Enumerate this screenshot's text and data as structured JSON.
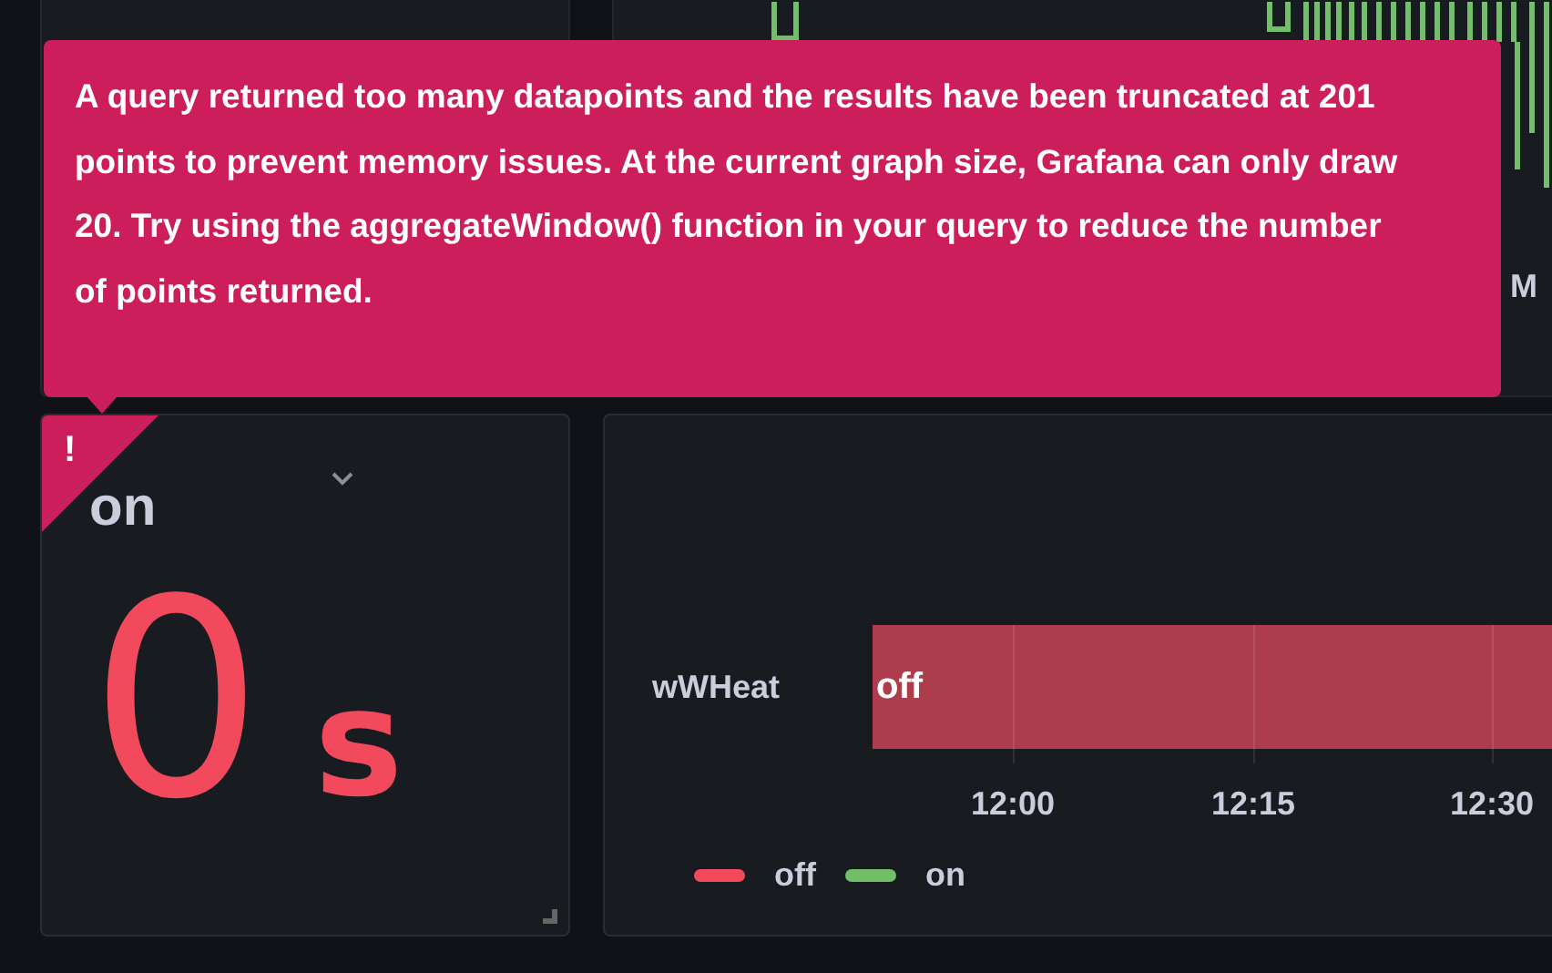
{
  "top_panel": {
    "axis_label": "M"
  },
  "alert": {
    "icon": "!",
    "message": "A query returned too many datapoints and the results have been truncated at 201 points to prevent memory issues. At the current graph size, Grafana can only draw 20. Try using the aggregateWindow() function in your query to reduce the number of points returned."
  },
  "stat_panel": {
    "title": "on",
    "value": "0",
    "unit": "s",
    "color": "#f2495c"
  },
  "state_timeline": {
    "rows": [
      {
        "label": "wWHeat",
        "state": "off",
        "color": "#ad3d4c"
      }
    ],
    "xticks": [
      "12:00",
      "12:15",
      "12:30"
    ],
    "legend": [
      {
        "label": "off",
        "color": "#f2495c"
      },
      {
        "label": "on",
        "color": "#73bf69"
      }
    ]
  }
}
